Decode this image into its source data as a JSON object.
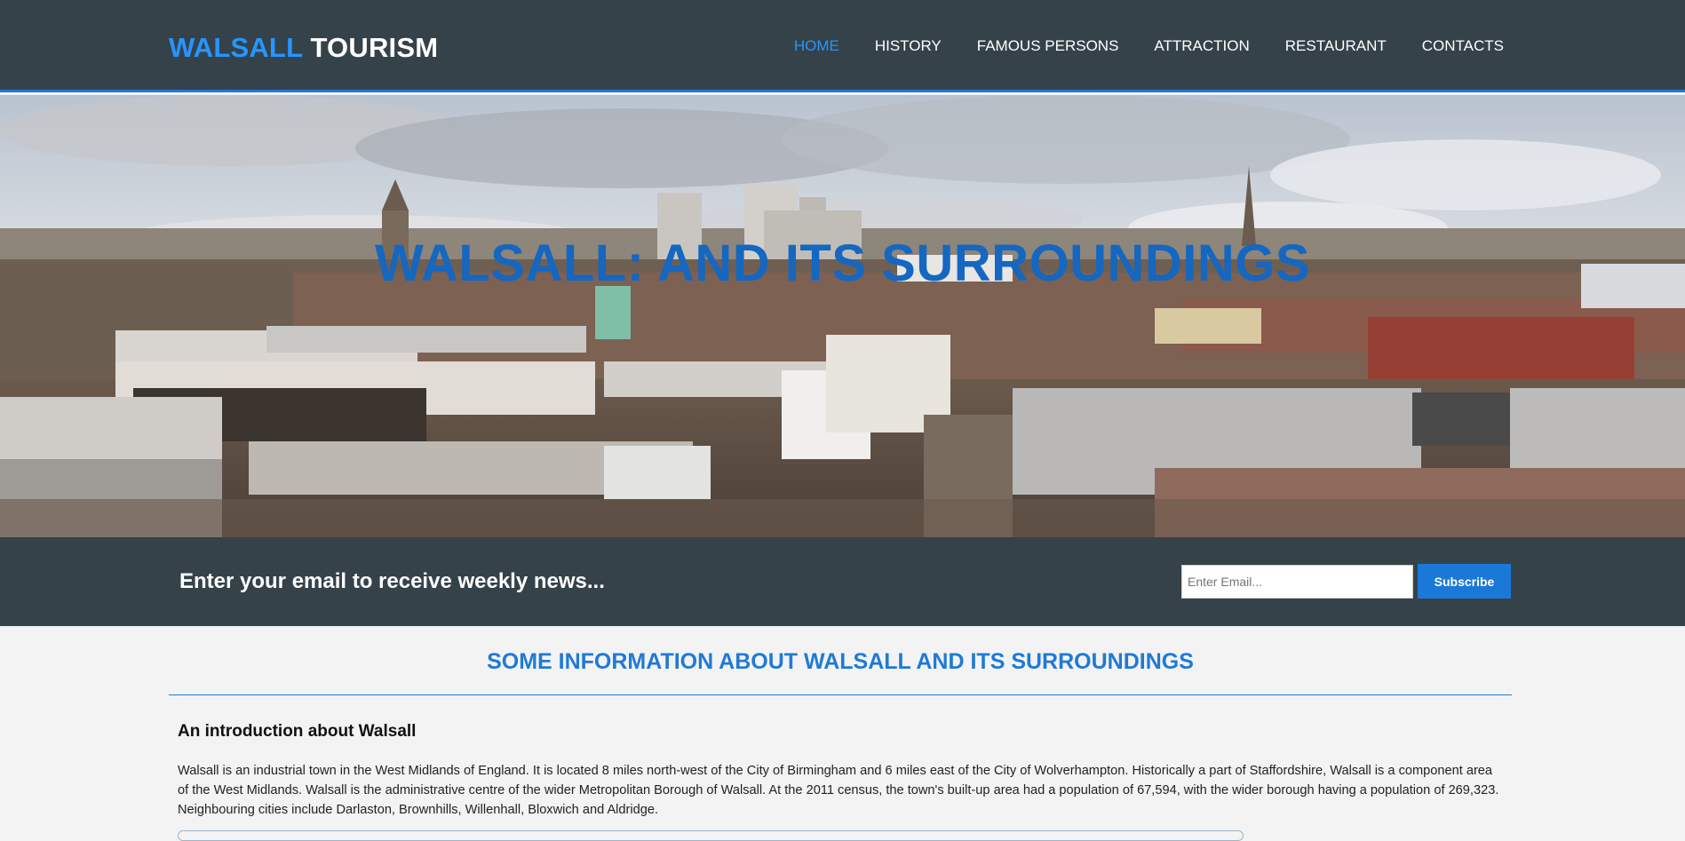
{
  "header": {
    "logo_accent": "WALSALL",
    "logo_rest": "TOURISM",
    "nav": [
      {
        "label": "HOME",
        "active": true
      },
      {
        "label": "HISTORY",
        "active": false
      },
      {
        "label": "FAMOUS PERSONS",
        "active": false
      },
      {
        "label": "ATTRACTION",
        "active": false
      },
      {
        "label": "RESTAURANT",
        "active": false
      },
      {
        "label": "CONTACTS",
        "active": false
      }
    ]
  },
  "hero": {
    "title": "WALSALL: AND ITS SURROUNDINGS",
    "image": "walsall-town-panorama"
  },
  "newsletter": {
    "text": "Enter your email to receive weekly news...",
    "email_placeholder": "Enter Email...",
    "subscribe_label": "Subscribe"
  },
  "main": {
    "section_title": "SOME INFORMATION ABOUT WALSALL AND ITS SURROUNDINGS",
    "intro_heading": "An introduction about Walsall",
    "intro_text": "Walsall is an industrial town in the West Midlands of England. It is located 8 miles north-west of the City of Birmingham and 6 miles east of the City of Wolverhampton. Historically a part of Staffordshire, Walsall is a component area of the West Midlands. Walsall is the administrative centre of the wider Metropolitan Borough of Walsall. At the 2011 census, the town's built-up area had a population of 67,594, with the wider borough having a population of 269,323. Neighbouring cities include Darlaston, Brownhills, Willenhall, Bloxwich and Aldridge."
  },
  "colors": {
    "header_bg": "#35424a",
    "accent": "#1f7ad6",
    "hero_title": "#1567c0",
    "page_bg": "#f3f3f3"
  }
}
